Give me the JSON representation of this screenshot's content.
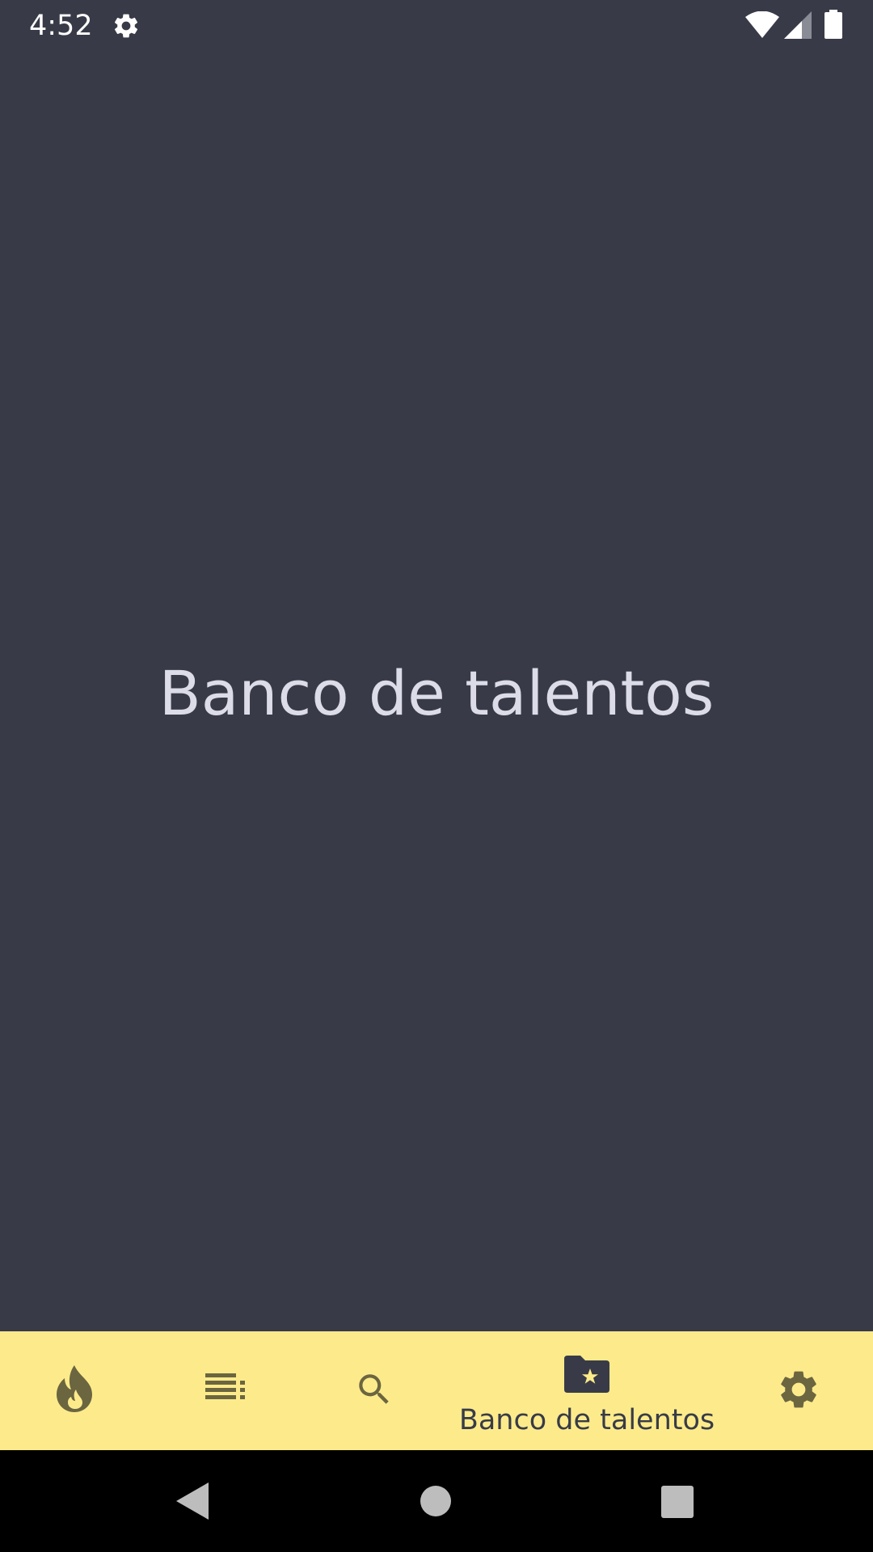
{
  "status_bar": {
    "time": "4:52",
    "icons": [
      "settings-gear-icon",
      "wifi-icon",
      "cellular-signal-icon",
      "battery-icon"
    ]
  },
  "main": {
    "title": "Banco de talentos"
  },
  "bottom_nav": {
    "items": [
      {
        "icon": "flame-icon",
        "label": "",
        "active": false
      },
      {
        "icon": "list-icon",
        "label": "",
        "active": false
      },
      {
        "icon": "search-icon",
        "label": "",
        "active": false
      },
      {
        "icon": "folder-star-icon",
        "label": "Banco de talentos",
        "active": true
      },
      {
        "icon": "gear-icon",
        "label": "",
        "active": false
      }
    ],
    "background": "#fdeb8b",
    "icon_color": "#6b6540",
    "active_color": "#383b47"
  },
  "system_nav": {
    "buttons": [
      "back-icon",
      "home-icon",
      "recents-icon"
    ]
  },
  "colors": {
    "background": "#383b47",
    "title_text": "#dcdce8",
    "status_text": "#ffffff"
  }
}
